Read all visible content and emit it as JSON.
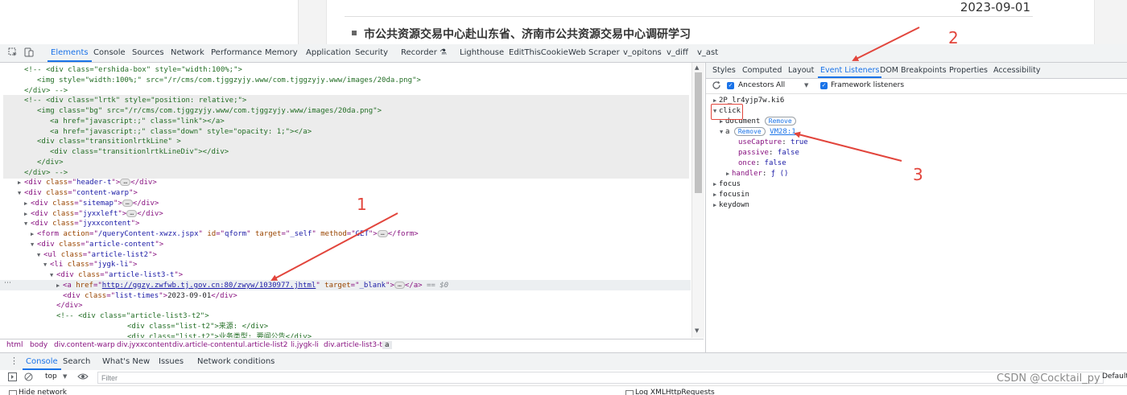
{
  "page": {
    "date": "2023-09-01",
    "headline": "市公共资源交易中心赴山东省、济南市公共资源交易中心调研学习"
  },
  "devtools": {
    "tabs": [
      "Elements",
      "Console",
      "Sources",
      "Network",
      "Performance",
      "Memory",
      "Application",
      "Security",
      "Recorder ⚗",
      "Lighthouse",
      "EditThisCookie",
      "Web Scraper",
      "v_opitons",
      "v_diff",
      "v_ast"
    ],
    "active_tab": "Elements"
  },
  "elements": {
    "lines": [
      {
        "indent": 2,
        "tw": "",
        "segs": [
          [
            "cm",
            "<!--  "
          ],
          [
            "cm",
            "<div class=\"ershida-box\" style=\"width:100%;\">"
          ]
        ]
      },
      {
        "indent": 4,
        "tw": "",
        "segs": [
          [
            "cm",
            "<img style=\"width:100%;\" src=\"/r/cms/com.tjggzyjy.www/com.tjggzyjy.www/images/20da.png\">"
          ]
        ]
      },
      {
        "indent": 2,
        "tw": "",
        "segs": [
          [
            "cm",
            "</div> -->"
          ]
        ]
      },
      {
        "indent": 2,
        "tw": "",
        "segs": [
          [
            "cm",
            "<!-- <div class=\"lrtk\" style=\"position: relative;\">"
          ]
        ]
      },
      {
        "indent": 4,
        "tw": "",
        "segs": [
          [
            "cm",
            "<img class=\"bg\" src=\"/r/cms/com.tjggzyjy.www/com.tjggzyjy.www/images/20da.png\">"
          ]
        ]
      },
      {
        "indent": 6,
        "tw": "",
        "segs": [
          [
            "cm",
            "<a href=\"javascript:;\" class=\"link\"></a>"
          ]
        ]
      },
      {
        "indent": 6,
        "tw": "",
        "segs": [
          [
            "cm",
            "<a href=\"javascript:;\" class=\"down\" style=\"opacity: 1;\"></a>"
          ]
        ]
      },
      {
        "indent": 4,
        "tw": "",
        "segs": [
          [
            "cm",
            "<div class=\"transitionlrtkLine\" >"
          ]
        ]
      },
      {
        "indent": 6,
        "tw": "",
        "segs": [
          [
            "cm",
            "<div class=\"transitionlrtkLineDiv\"></div>"
          ]
        ]
      },
      {
        "indent": 4,
        "tw": "",
        "segs": [
          [
            "cm",
            "</div>"
          ]
        ]
      },
      {
        "indent": 2,
        "tw": "",
        "segs": [
          [
            "cm",
            "</div> -->"
          ]
        ]
      },
      {
        "indent": 2,
        "tw": "▶",
        "segs": [
          [
            "tag",
            "<div "
          ],
          [
            "an",
            "class"
          ],
          [
            "tag",
            "=\""
          ],
          [
            "av",
            "header-t"
          ],
          [
            "tag",
            "\">"
          ],
          [
            "el",
            "…"
          ],
          [
            "tag",
            "</div>"
          ]
        ]
      },
      {
        "indent": 2,
        "tw": "▼",
        "segs": [
          [
            "tag",
            "<div "
          ],
          [
            "an",
            "class"
          ],
          [
            "tag",
            "=\""
          ],
          [
            "av",
            "content-warp"
          ],
          [
            "tag",
            "\">"
          ]
        ]
      },
      {
        "indent": 3,
        "tw": "▶",
        "segs": [
          [
            "tag",
            "<div "
          ],
          [
            "an",
            "class"
          ],
          [
            "tag",
            "=\""
          ],
          [
            "av",
            "sitemap"
          ],
          [
            "tag",
            "\">"
          ],
          [
            "el",
            "…"
          ],
          [
            "tag",
            "</div>"
          ]
        ]
      },
      {
        "indent": 3,
        "tw": "▶",
        "segs": [
          [
            "tag",
            "<div "
          ],
          [
            "an",
            "class"
          ],
          [
            "tag",
            "=\""
          ],
          [
            "av",
            "jyxxleft"
          ],
          [
            "tag",
            "\">"
          ],
          [
            "el",
            "…"
          ],
          [
            "tag",
            "</div>"
          ]
        ]
      },
      {
        "indent": 3,
        "tw": "▼",
        "segs": [
          [
            "tag",
            "<div "
          ],
          [
            "an",
            "class"
          ],
          [
            "tag",
            "=\""
          ],
          [
            "av",
            "jyxxcontent"
          ],
          [
            "tag",
            "\">"
          ]
        ]
      },
      {
        "indent": 4,
        "tw": "▶",
        "segs": [
          [
            "tag",
            "<form "
          ],
          [
            "an",
            "action"
          ],
          [
            "tag",
            "=\""
          ],
          [
            "av",
            "/queryContent-xwzx.jspx"
          ],
          [
            "tag",
            "\" "
          ],
          [
            "an",
            "id"
          ],
          [
            "tag",
            "=\""
          ],
          [
            "av",
            "qform"
          ],
          [
            "tag",
            "\" "
          ],
          [
            "an",
            "target"
          ],
          [
            "tag",
            "=\""
          ],
          [
            "av",
            "_self"
          ],
          [
            "tag",
            "\" "
          ],
          [
            "an",
            "method"
          ],
          [
            "tag",
            "=\""
          ],
          [
            "av",
            "GET"
          ],
          [
            "tag",
            "\">"
          ],
          [
            "el",
            "…"
          ],
          [
            "tag",
            "</form>"
          ]
        ]
      },
      {
        "indent": 4,
        "tw": "▼",
        "segs": [
          [
            "tag",
            "<div "
          ],
          [
            "an",
            "class"
          ],
          [
            "tag",
            "=\""
          ],
          [
            "av",
            "article-content"
          ],
          [
            "tag",
            "\">"
          ]
        ]
      },
      {
        "indent": 5,
        "tw": "▼",
        "segs": [
          [
            "tag",
            "<ul "
          ],
          [
            "an",
            "class"
          ],
          [
            "tag",
            "=\""
          ],
          [
            "av",
            "article-list2"
          ],
          [
            "tag",
            "\">"
          ]
        ]
      },
      {
        "indent": 6,
        "tw": "▼",
        "segs": [
          [
            "tag",
            "<li "
          ],
          [
            "an",
            "class"
          ],
          [
            "tag",
            "=\""
          ],
          [
            "av",
            "jygk-li"
          ],
          [
            "tag",
            "\">"
          ]
        ]
      },
      {
        "indent": 7,
        "tw": "▼",
        "segs": [
          [
            "tag",
            "<div "
          ],
          [
            "an",
            "class"
          ],
          [
            "tag",
            "=\""
          ],
          [
            "av",
            "article-list3-t"
          ],
          [
            "tag",
            "\">"
          ]
        ]
      },
      {
        "indent": 8,
        "tw": "▶",
        "selected": true,
        "segs": [
          [
            "tag",
            "<a "
          ],
          [
            "an",
            "href"
          ],
          [
            "tag",
            "=\""
          ],
          [
            "link",
            "http://ggzy.zwfwb.tj.gov.cn:80/zwyw/1030977.jhtml"
          ],
          [
            "tag",
            "\" "
          ],
          [
            "an",
            "target"
          ],
          [
            "tag",
            "=\""
          ],
          [
            "av",
            "_blank"
          ],
          [
            "tag",
            "\">"
          ],
          [
            "el",
            "…"
          ],
          [
            "tag",
            "</a>"
          ],
          [
            "dim",
            " == $0"
          ]
        ]
      },
      {
        "indent": 8,
        "tw": "",
        "segs": [
          [
            "tag",
            "<div "
          ],
          [
            "an",
            "class"
          ],
          [
            "tag",
            "=\""
          ],
          [
            "av",
            "list-times"
          ],
          [
            "tag",
            "\">"
          ],
          [
            "tx",
            "2023-09-01"
          ],
          [
            "tag",
            "</div>"
          ]
        ]
      },
      {
        "indent": 7,
        "tw": "",
        "segs": [
          [
            "tag",
            "</div>"
          ]
        ]
      },
      {
        "indent": 7,
        "tw": "",
        "segs": [
          [
            "cm",
            "<!-- <div class=\"article-list3-t2\">"
          ]
        ]
      },
      {
        "indent": 18,
        "tw": "",
        "segs": [
          [
            "cm",
            "<div class=\"list-t2\">来源: </div>"
          ]
        ]
      },
      {
        "indent": 18,
        "tw": "",
        "segs": [
          [
            "cm",
            "<div class=\"list-t2\">业务类型: 要闻公告</div>"
          ]
        ]
      }
    ]
  },
  "breadcrumb": [
    "html",
    "body",
    "div.content-warp",
    "div.jyxxcontent",
    "div.article-content",
    "ul.article-list2",
    "li.jygk-li",
    "div.article-list3-t",
    "a"
  ],
  "sidebar": {
    "tabs": [
      "Styles",
      "Computed",
      "Layout",
      "Event Listeners",
      "DOM Breakpoints",
      "Properties",
      "Accessibility"
    ],
    "active_tab": "Event Listeners",
    "refresh_icon": "refresh-icon",
    "ancestors_label": "Ancestors",
    "ancestors_select": "All",
    "framework_label": "Framework listeners",
    "remove_label": "Remove",
    "listener_lines": [
      {
        "indent": 0,
        "tw": "▶",
        "text": "2P_lr4yjp7w.ki6"
      },
      {
        "indent": 0,
        "tw": "▼",
        "text": "click"
      },
      {
        "indent": 1,
        "tw": "▶",
        "text": "document",
        "remove": true
      },
      {
        "indent": 1,
        "tw": "▼",
        "text": "a",
        "remove": true,
        "link": "VM28:1"
      },
      {
        "indent": 3,
        "tw": "",
        "key": "useCapture",
        "val": "true"
      },
      {
        "indent": 3,
        "tw": "",
        "key": "passive",
        "val": "false"
      },
      {
        "indent": 3,
        "tw": "",
        "key": "once",
        "val": "false"
      },
      {
        "indent": 2,
        "tw": "▶",
        "key": "handler",
        "val": "ƒ ()"
      },
      {
        "indent": 0,
        "tw": "▶",
        "text": "focus"
      },
      {
        "indent": 0,
        "tw": "▶",
        "text": "focusin"
      },
      {
        "indent": 0,
        "tw": "▶",
        "text": "keydown"
      }
    ]
  },
  "drawer": {
    "tabs": [
      "Console",
      "Search",
      "What's New",
      "Issues",
      "Network conditions"
    ],
    "active_tab": "Console",
    "context": "top",
    "filter_placeholder": "Filter",
    "default_levels": "Default",
    "hide_network": "Hide network",
    "log_xhr": "Log XMLHttpRequests"
  },
  "annotations": {
    "numbers": [
      "1",
      "2",
      "3"
    ],
    "color": "#e2453c"
  },
  "watermark": "CSDN @Cocktail_py"
}
